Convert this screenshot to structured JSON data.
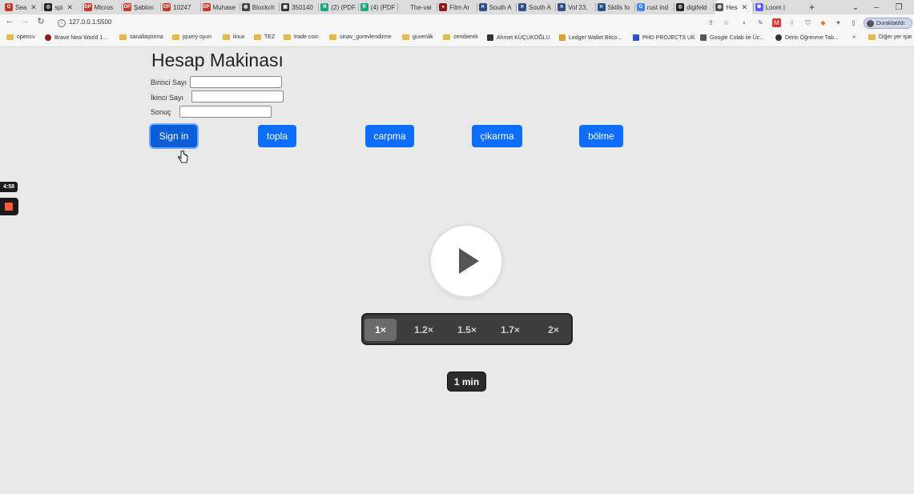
{
  "browser": {
    "tabs": [
      {
        "label": "Sea",
        "icon": "#c0392b",
        "icon_text": "G"
      },
      {
        "label": "spi",
        "icon": "#222222",
        "icon_text": "◎"
      },
      {
        "label": "Micros",
        "icon": "#c0392b",
        "icon_text": "DP"
      },
      {
        "label": "Şablon",
        "icon": "#c0392b",
        "icon_text": "DP"
      },
      {
        "label": "10247",
        "icon": "#c0392b",
        "icon_text": "DP"
      },
      {
        "label": "Muhase",
        "icon": "#c0392b",
        "icon_text": "DP"
      },
      {
        "label": "Blockch",
        "icon": "#444444",
        "icon_text": "◍"
      },
      {
        "label": "350140",
        "icon": "#333333",
        "icon_text": "▣"
      },
      {
        "label": "(2) (PDF",
        "icon": "#21a57f",
        "icon_text": "R"
      },
      {
        "label": "(4) (PDF",
        "icon": "#21a57f",
        "icon_text": "R"
      },
      {
        "label": "The-vai",
        "icon": "#dddddd",
        "icon_text": ""
      },
      {
        "label": "Film Ar",
        "icon": "#8b1a1a",
        "icon_text": "●"
      },
      {
        "label": "South A",
        "icon": "#2c4f8a",
        "icon_text": "✕"
      },
      {
        "label": "South A",
        "icon": "#2c4f8a",
        "icon_text": "✕"
      },
      {
        "label": "Vol 23,",
        "icon": "#2c4f8a",
        "icon_text": "✕"
      },
      {
        "label": "Skills fo",
        "icon": "#2c4f8a",
        "icon_text": "✕"
      },
      {
        "label": "rust ind",
        "icon": "#4285f4",
        "icon_text": "G"
      },
      {
        "label": "digifeld",
        "icon": "#222222",
        "icon_text": "◎"
      },
      {
        "label": "Hes",
        "icon": "#555555",
        "icon_text": "◍"
      },
      {
        "label": "Loom |",
        "icon": "#625df5",
        "icon_text": "✺"
      }
    ],
    "new_tab": "+",
    "url": "127.0.0.1:5500",
    "profile_label": "Duraklatıldı",
    "bookmarks": [
      {
        "label": "opencv",
        "kind": "folder"
      },
      {
        "label": "Brave New World 1...",
        "kind": "dot",
        "color": "#8b1a1a"
      },
      {
        "label": "sanallaştırma",
        "kind": "folder"
      },
      {
        "label": "jquery oyun",
        "kind": "folder"
      },
      {
        "label": "linux",
        "kind": "folder"
      },
      {
        "label": "TEZ",
        "kind": "folder"
      },
      {
        "label": "trade coin",
        "kind": "folder"
      },
      {
        "label": "sinav_gorevlendirme",
        "kind": "folder"
      },
      {
        "label": "guvenlik",
        "kind": "folder"
      },
      {
        "label": "zemberek",
        "kind": "folder"
      },
      {
        "label": "Ahmet KÜÇÜKOĞLU",
        "kind": "sq",
        "color": "#333333"
      },
      {
        "label": "Ledger Wallet Bitco...",
        "kind": "sq",
        "color": "#e0a030"
      },
      {
        "label": "PHD PROJECTS UK",
        "kind": "sq",
        "color": "#2a55c8"
      },
      {
        "label": "Google Colab ile Üc...",
        "kind": "sq",
        "color": "#555555"
      },
      {
        "label": "Derin Öğrenme Tab...",
        "kind": "dot",
        "color": "#333333"
      }
    ],
    "bookmarks_more": "»",
    "other_bookmarks": "Diğer yer işar"
  },
  "page": {
    "heading": "Hesap Makinası",
    "field1_label": "Birinci Sayı",
    "field2_label": "İkinci Sayı",
    "result_label": "Sonuç",
    "field1_value": "",
    "field2_value": "",
    "result_value": "",
    "buttons": {
      "signin": "Sign in",
      "add": "topla",
      "multiply": "carpma",
      "subtract": "çikarma",
      "divide": "bölme"
    }
  },
  "recorder": {
    "elapsed": "4:58"
  },
  "video": {
    "speeds": [
      "1×",
      "1.2×",
      "1.5×",
      "1.7×",
      "2×"
    ],
    "selected_speed": "1×",
    "duration": "1 min"
  },
  "colors": {
    "primary_button": "#0d6efd",
    "stop_button": "#ff5c35"
  }
}
